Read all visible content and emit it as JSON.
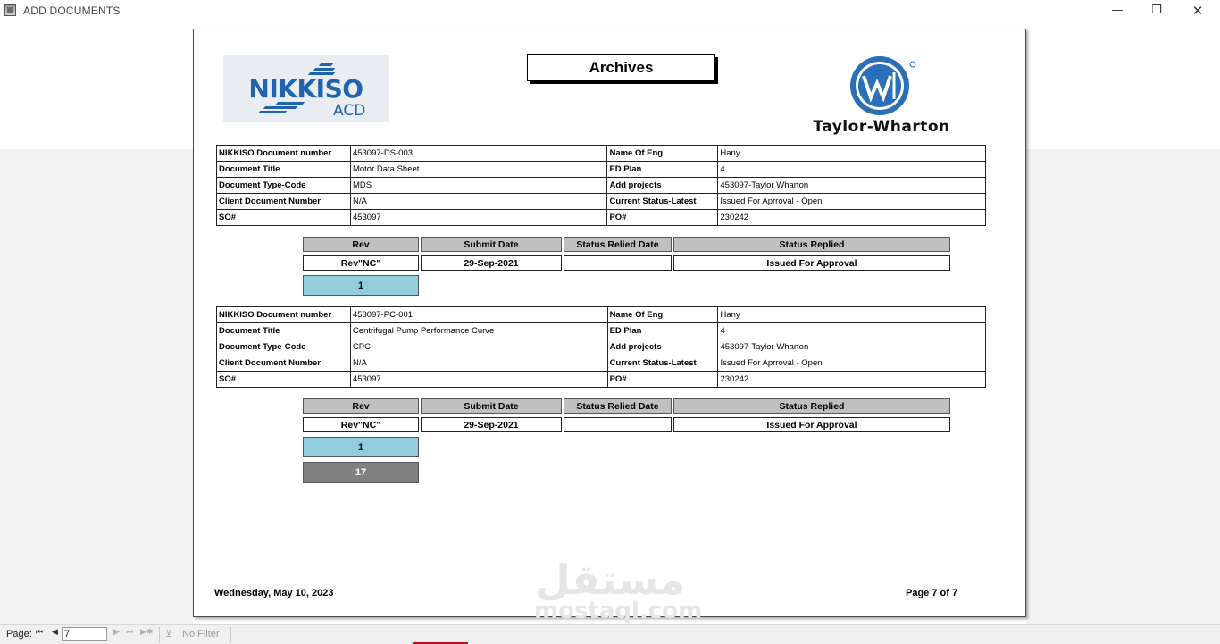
{
  "window": {
    "title": "ADD DOCUMENTS",
    "minimize_glyph": "—",
    "restore_glyph": "❐",
    "close_glyph": "✕"
  },
  "report": {
    "title": "Archives",
    "logos": {
      "left_name": "NIKKISO",
      "left_sub": "ACD",
      "right_name": "Taylor-Wharton"
    },
    "labels": {
      "doc_number": "NIKKISO Document number",
      "doc_title": "Document Title",
      "doc_type": "Document Type-Code",
      "client_doc": "Client Document Number",
      "so": "SO#",
      "eng": "Name Of Eng",
      "ed_plan": "ED Plan",
      "projects": "Add projects",
      "status": "Current Status-Latest",
      "po": "PO#"
    },
    "rev_headers": {
      "rev": "Rev",
      "submit": "Submit Date",
      "relied": "Status Relied Date",
      "replied": "Status Replied"
    },
    "documents": [
      {
        "doc_number": "453097-DS-003",
        "doc_title": "Motor Data Sheet",
        "doc_type": "MDS",
        "client_doc": "N/A",
        "so": "453097",
        "eng": "Hany",
        "ed_plan": "4",
        "projects": "453097-Taylor Wharton",
        "status": "Issued For Aprroval - Open",
        "po": "230242",
        "revision": {
          "rev": "Rev\"NC\"",
          "submit": "29-Sep-2021",
          "relied": "",
          "replied": "Issued For Approval"
        },
        "count": "1"
      },
      {
        "doc_number": "453097-PC-001",
        "doc_title": "Centrifugal Pump Performance Curve",
        "doc_type": "CPC",
        "client_doc": "N/A",
        "so": "453097",
        "eng": "Hany",
        "ed_plan": "4",
        "projects": "453097-Taylor Wharton",
        "status": "Issued For Aprroval - Open",
        "po": "230242",
        "revision": {
          "rev": "Rev\"NC\"",
          "submit": "29-Sep-2021",
          "relied": "",
          "replied": "Issued For Approval"
        },
        "count": "1"
      }
    ],
    "total": "17",
    "footer_date": "Wednesday, May 10, 2023",
    "footer_page": "Page 7 of 7"
  },
  "watermark": {
    "arabic": "مستقل",
    "latin": "mostaql.com"
  },
  "statusbar": {
    "page_label": "Page:",
    "page_value": "7",
    "filter_label": "No Filter",
    "nav_first": "⏮",
    "nav_prev": "◀",
    "nav_next": "▶",
    "nav_last": "⏭",
    "nav_new": "▶✱"
  },
  "colors": {
    "count_blue": "#92cddc",
    "count_gray": "#808080",
    "header_gray": "#c0c0c0",
    "nikkiso_blue": "#1f64ad",
    "accent_red": "#b5121b"
  }
}
